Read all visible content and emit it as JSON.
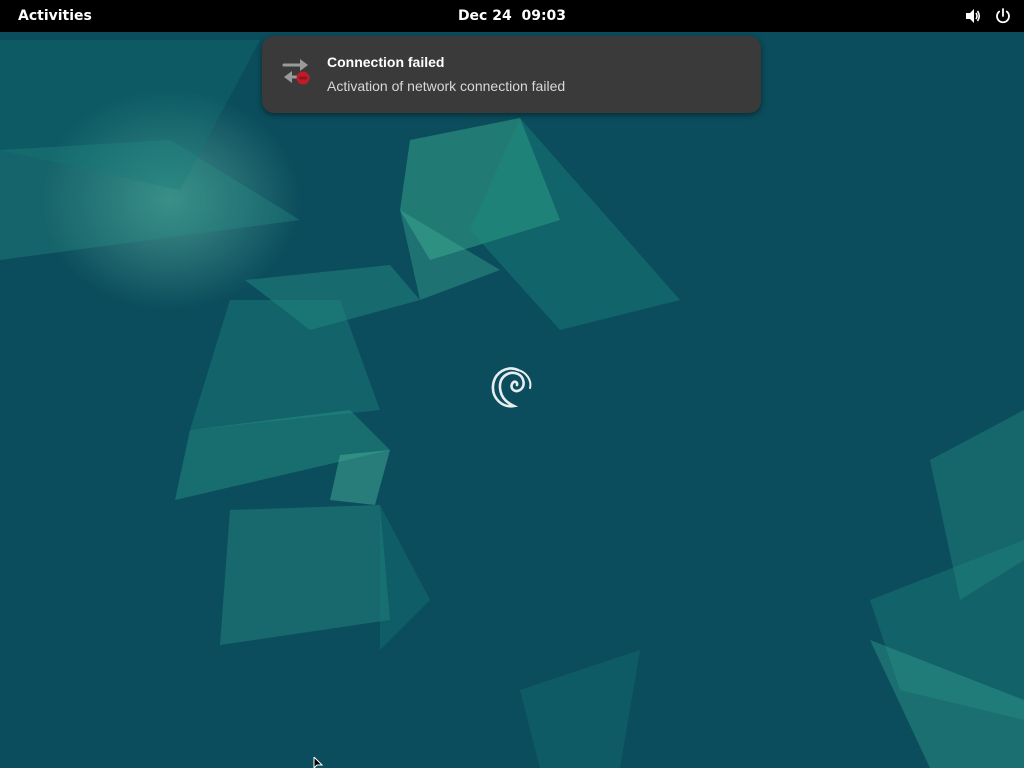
{
  "topbar": {
    "activities_label": "Activities",
    "clock_date": "Dec 24",
    "clock_time": "09:03"
  },
  "tray": {
    "volume_icon": "volume-icon",
    "power_icon": "power-icon"
  },
  "notification": {
    "icon": "network-error-icon",
    "title": "Connection failed",
    "body": "Activation of network connection failed"
  },
  "desktop": {
    "loading_icon": "debian-swirl-icon"
  },
  "colors": {
    "topbar": "#000000",
    "notification_bg": "#3a3a3a",
    "error_red": "#c01c28",
    "wallpaper_teal": "#0e5c66"
  }
}
